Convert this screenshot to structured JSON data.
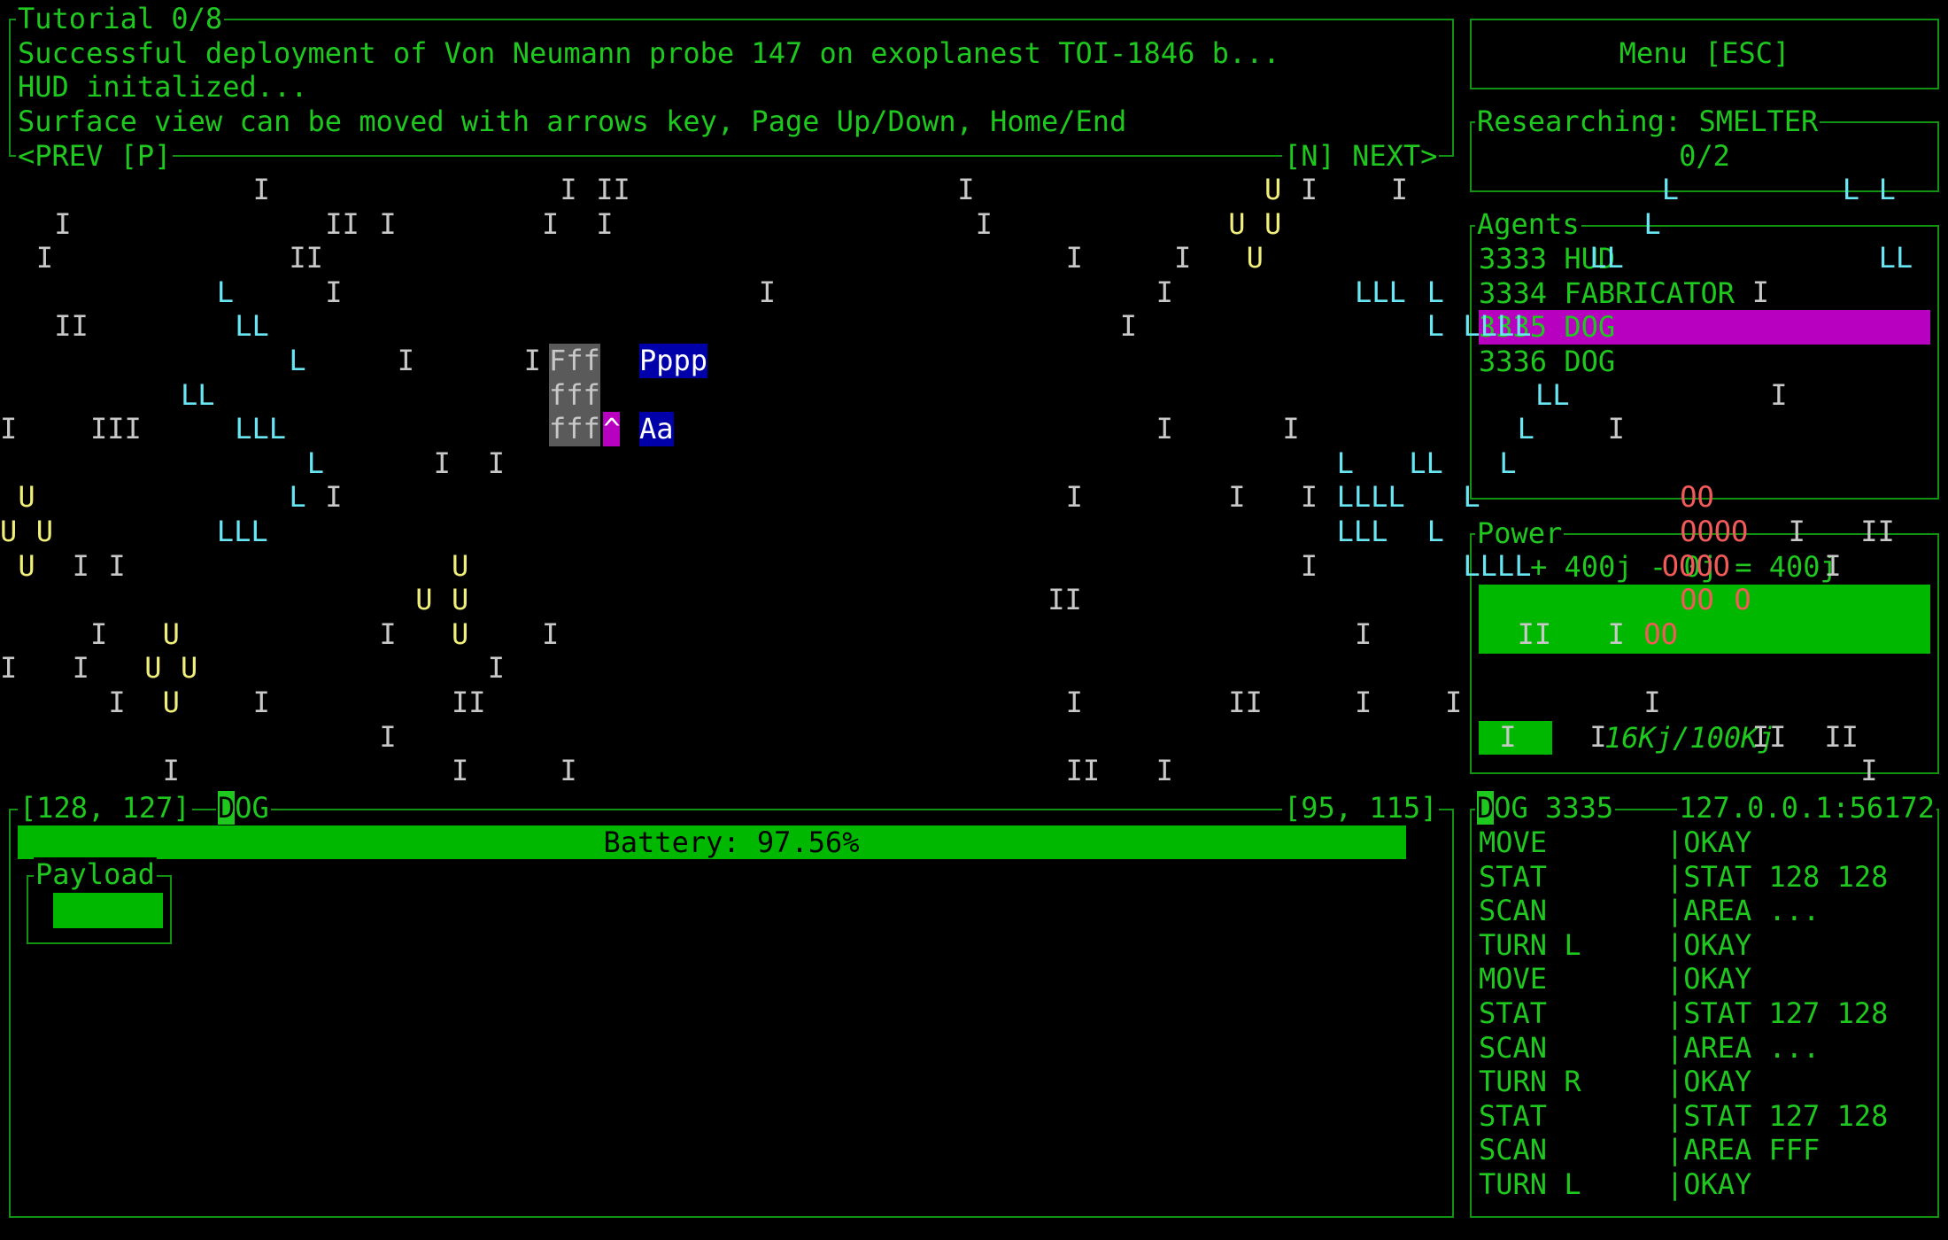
{
  "tutorial": {
    "title": "Tutorial 0/8",
    "lines": [
      "Successful deployment of Von Neumann probe 147 on exoplanest TOI-1846 b...",
      "HUD initalized...",
      "Surface view can be moved with arrows key, Page Up/Down, Home/End"
    ],
    "prev_label": "<PREV [P]",
    "next_label": "[N] NEXT>"
  },
  "menu": {
    "label": "Menu [ESC]"
  },
  "research": {
    "title": "Researching: SMELTER",
    "progress": "0/2"
  },
  "agents": {
    "title": "Agents",
    "items": [
      {
        "id": "3333",
        "name": "HUD"
      },
      {
        "id": "3334",
        "name": "FABRICATOR"
      },
      {
        "id": "3335",
        "name": "DOG"
      },
      {
        "id": "3336",
        "name": "DOG"
      }
    ],
    "selected_index": 2
  },
  "power": {
    "title": "Power",
    "equation": "+ 400j - 0j = 400j",
    "storage_text": "16Kj/100Kj",
    "storage_fraction": 0.16
  },
  "map": {
    "rows": [
      [
        [
          14,
          "I",
          "g"
        ],
        [
          31,
          "I",
          "g"
        ],
        [
          33,
          "II",
          "g"
        ],
        [
          53,
          "I",
          "g"
        ],
        [
          70,
          "U",
          "y"
        ],
        [
          72,
          "I",
          "g"
        ],
        [
          77,
          "I",
          "g"
        ],
        [
          92,
          "L",
          "c"
        ],
        [
          102,
          "L",
          "c"
        ],
        [
          104,
          "L",
          "c"
        ]
      ],
      [
        [
          3,
          "I",
          "g"
        ],
        [
          18,
          "II",
          "g"
        ],
        [
          21,
          "I",
          "g"
        ],
        [
          30,
          "I",
          "g"
        ],
        [
          33,
          "I",
          "g"
        ],
        [
          54,
          "I",
          "g"
        ],
        [
          68,
          "U",
          "y"
        ],
        [
          70,
          "U",
          "y"
        ],
        [
          91,
          "L",
          "c"
        ]
      ],
      [
        [
          2,
          "I",
          "g"
        ],
        [
          16,
          "II",
          "g"
        ],
        [
          59,
          "I",
          "g"
        ],
        [
          65,
          "I",
          "g"
        ],
        [
          69,
          "U",
          "y"
        ],
        [
          88,
          "LL",
          "c"
        ],
        [
          104,
          "LL",
          "c"
        ]
      ],
      [
        [
          12,
          "L",
          "c"
        ],
        [
          18,
          "I",
          "g"
        ],
        [
          42,
          "I",
          "g"
        ],
        [
          64,
          "I",
          "g"
        ],
        [
          75,
          "LLL",
          "c"
        ],
        [
          79,
          "L",
          "c"
        ],
        [
          97,
          "I",
          "g"
        ]
      ],
      [
        [
          3,
          "II",
          "g"
        ],
        [
          13,
          "LL",
          "c"
        ],
        [
          62,
          "I",
          "g"
        ],
        [
          79,
          "L",
          "c"
        ],
        [
          81,
          "LLLL",
          "c"
        ]
      ],
      [
        [
          16,
          "L",
          "c"
        ],
        [
          22,
          "I",
          "g"
        ],
        [
          29,
          "I",
          "g"
        ]
      ],
      [
        [
          10,
          "LL",
          "c"
        ],
        [
          31,
          "I",
          "g"
        ],
        [
          85,
          "LL",
          "c"
        ],
        [
          98,
          "I",
          "g"
        ]
      ],
      [
        [
          0,
          "I",
          "g"
        ],
        [
          5,
          "III",
          "g"
        ],
        [
          13,
          "LLL",
          "c"
        ],
        [
          64,
          "I",
          "g"
        ],
        [
          71,
          "I",
          "g"
        ],
        [
          84,
          "L",
          "c"
        ],
        [
          89,
          "I",
          "g"
        ]
      ],
      [
        [
          17,
          "L",
          "c"
        ],
        [
          24,
          "I",
          "g"
        ],
        [
          27,
          "I",
          "g"
        ],
        [
          74,
          "L",
          "c"
        ],
        [
          78,
          "LL",
          "c"
        ],
        [
          83,
          "L",
          "c"
        ]
      ],
      [
        [
          1,
          "U",
          "y"
        ],
        [
          16,
          "L",
          "c"
        ],
        [
          18,
          "I",
          "g"
        ],
        [
          59,
          "I",
          "g"
        ],
        [
          68,
          "I",
          "g"
        ],
        [
          72,
          "I",
          "g"
        ],
        [
          74,
          "LLLL",
          "c"
        ],
        [
          81,
          "L",
          "c"
        ],
        [
          93,
          "OO",
          "r"
        ]
      ],
      [
        [
          0,
          "U",
          "y"
        ],
        [
          2,
          "U",
          "y"
        ],
        [
          12,
          "LLL",
          "c"
        ],
        [
          74,
          "LLL",
          "c"
        ],
        [
          79,
          "L",
          "c"
        ],
        [
          93,
          "OOOO",
          "r"
        ],
        [
          99,
          "I",
          "g"
        ],
        [
          103,
          "II",
          "g"
        ]
      ],
      [
        [
          1,
          "U",
          "y"
        ],
        [
          4,
          "I",
          "g"
        ],
        [
          6,
          "I",
          "g"
        ],
        [
          25,
          "U",
          "y"
        ],
        [
          72,
          "I",
          "g"
        ],
        [
          81,
          "LLLL",
          "c"
        ],
        [
          92,
          "OOOO",
          "r"
        ],
        [
          101,
          "I",
          "g"
        ]
      ],
      [
        [
          23,
          "U",
          "y"
        ],
        [
          25,
          "U",
          "y"
        ],
        [
          58,
          "II",
          "g"
        ],
        [
          93,
          "OO",
          "r"
        ],
        [
          96,
          "O",
          "r"
        ]
      ],
      [
        [
          5,
          "I",
          "g"
        ],
        [
          9,
          "U",
          "y"
        ],
        [
          21,
          "I",
          "g"
        ],
        [
          25,
          "U",
          "y"
        ],
        [
          30,
          "I",
          "g"
        ],
        [
          75,
          "I",
          "g"
        ],
        [
          84,
          "II",
          "g"
        ],
        [
          89,
          "I",
          "g"
        ],
        [
          91,
          "OO",
          "r"
        ]
      ],
      [
        [
          0,
          "I",
          "g"
        ],
        [
          4,
          "I",
          "g"
        ],
        [
          8,
          "U",
          "y"
        ],
        [
          10,
          "U",
          "y"
        ],
        [
          27,
          "I",
          "g"
        ]
      ],
      [
        [
          6,
          "I",
          "g"
        ],
        [
          9,
          "U",
          "y"
        ],
        [
          14,
          "I",
          "g"
        ],
        [
          25,
          "II",
          "g"
        ],
        [
          59,
          "I",
          "g"
        ],
        [
          68,
          "II",
          "g"
        ],
        [
          75,
          "I",
          "g"
        ],
        [
          80,
          "I",
          "g"
        ],
        [
          91,
          "I",
          "g"
        ]
      ],
      [
        [
          21,
          "I",
          "g"
        ],
        [
          83,
          "I",
          "g"
        ],
        [
          88,
          "I",
          "g"
        ],
        [
          97,
          "II",
          "g"
        ],
        [
          101,
          "II",
          "g"
        ]
      ],
      [
        [
          9,
          "I",
          "g"
        ],
        [
          25,
          "I",
          "g"
        ],
        [
          31,
          "I",
          "g"
        ],
        [
          59,
          "II",
          "g"
        ],
        [
          64,
          "I",
          "g"
        ],
        [
          103,
          "I",
          "g"
        ]
      ]
    ],
    "structures": {
      "row5": {
        "f": "Fff",
        "p": "Pppp"
      },
      "row6": {
        "f": "fff"
      },
      "row7": {
        "f": "fff",
        "arrow": "^",
        "a": "Aa"
      }
    }
  },
  "status": {
    "left_coords": "[128, 127]",
    "agent_label": "DOG",
    "right_coords": "[95, 115]",
    "battery_text": "Battery: 97.56%",
    "battery_fraction": 0.9756,
    "payload_title": "Payload"
  },
  "console": {
    "title": "DOG 3335",
    "address": "127.0.0.1:56172",
    "rows": [
      {
        "cmd": "MOVE",
        "resp": "OKAY"
      },
      {
        "cmd": "STAT",
        "resp": "STAT 128 128"
      },
      {
        "cmd": "SCAN",
        "resp": "AREA ..."
      },
      {
        "cmd": "TURN L",
        "resp": "OKAY"
      },
      {
        "cmd": "MOVE",
        "resp": "OKAY"
      },
      {
        "cmd": "STAT",
        "resp": "STAT 127 128"
      },
      {
        "cmd": "SCAN",
        "resp": "AREA ..."
      },
      {
        "cmd": "TURN R",
        "resp": "OKAY"
      },
      {
        "cmd": "STAT",
        "resp": "STAT 127 128"
      },
      {
        "cmd": "SCAN",
        "resp": "AREA FFF"
      },
      {
        "cmd": "TURN L",
        "resp": "OKAY"
      }
    ]
  },
  "colors": {
    "ui_green": "#1ec81e",
    "fill_green": "#00b800",
    "select_magenta": "#b800c0",
    "terrain_gray": "#c8c8c8",
    "terrain_yellow": "#f1ef7a",
    "terrain_cyan": "#69e6f3",
    "terrain_red": "#f25a5a"
  }
}
